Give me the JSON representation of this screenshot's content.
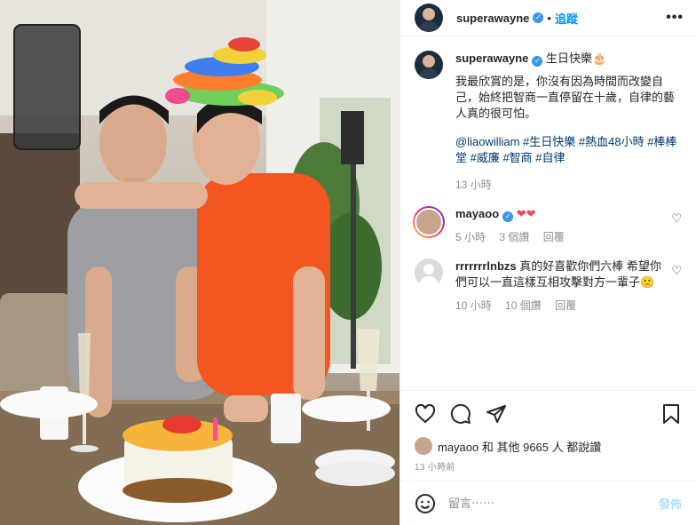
{
  "header": {
    "username": "superawayne",
    "follow_label": "追蹤",
    "more_label": "•••"
  },
  "caption": {
    "username": "superawayne",
    "title": "生日快樂🎂",
    "body": "我最欣賞的是，你沒有因為時間而改變自己，始終把智商一直停留在十歲，自律的藝人真的很可怕。",
    "tags": "@liaowilliam #生日快樂 #熱血48小時 #棒棒堂 #威廉 #智商 #自律",
    "time": "13 小時"
  },
  "comments": [
    {
      "username": "mayaoo",
      "text": "❤❤",
      "time": "5 小時",
      "likes": "3 個讚",
      "reply_label": "回覆"
    },
    {
      "username": "rrrrrrrlnbzs",
      "text": "真的好喜歡你們六棒 希望你們可以一直這樣互相攻擊對方一輩子🙁",
      "time": "10 小時",
      "likes": "10 個讚",
      "reply_label": "回覆"
    }
  ],
  "likes_summary": "mayaoo 和 其他 9665 人 都說讚",
  "post_time": "13 小時前",
  "add_comment": {
    "placeholder": "留言⋯⋯",
    "post_label": "發佈"
  },
  "colors": {
    "accent": "#0095f6",
    "verified": "#3897f0",
    "heart": "#ed4956"
  },
  "icons": [
    "verified-badge-icon",
    "more-options-icon",
    "heart-icon",
    "comment-icon",
    "share-icon",
    "save-icon",
    "emoji-icon"
  ]
}
